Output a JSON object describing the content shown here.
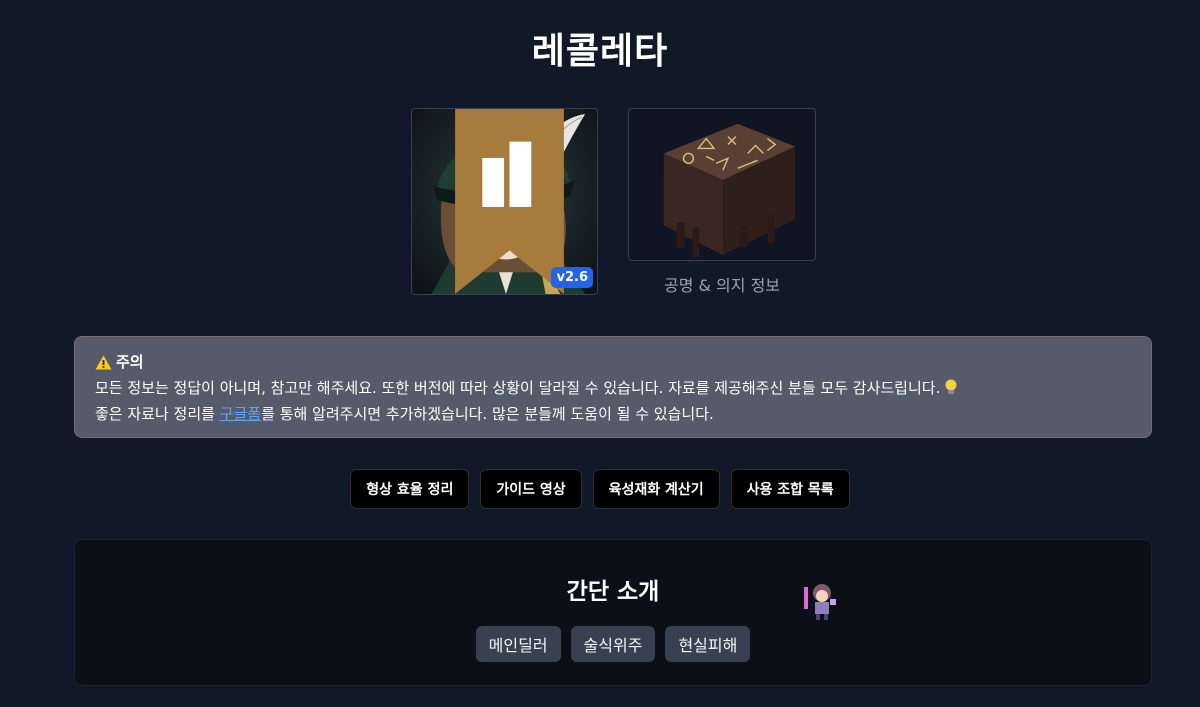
{
  "page": {
    "title": "레콜레타"
  },
  "character": {
    "version": "v2.6",
    "icon": "character-portrait",
    "attribute_icon": "intellect-attribute-icon"
  },
  "psychube": {
    "caption": "공명 & 의지 정보",
    "icon": "rune-table-image"
  },
  "notice": {
    "heading": "주의",
    "line1": "모든 정보는 정답이 아니며, 참고만 해주세요. 또한 버전에 따라 상황이 달라질 수 있습니다. 자료를 제공해주신 분들 모두 감사드립니다.",
    "line2_before": "좋은 자료나 정리를 ",
    "line2_link": "구글폼",
    "line2_after": "를 통해 알려주시면 추가하겠습니다. 많은 분들께 도움이 될 수 있습니다.",
    "colors": {
      "background": "#565b6b",
      "link": "#60a5fa"
    }
  },
  "buttons": [
    {
      "label": "형상 효율 정리"
    },
    {
      "label": "가이드 영상"
    },
    {
      "label": "육성재화 계산기"
    },
    {
      "label": "사용 조합 목록"
    }
  ],
  "intro": {
    "title": "간단 소개",
    "tags": [
      "메인딜러",
      "술식위주",
      "현실피해"
    ]
  },
  "colors": {
    "page_bg": "#111827",
    "version_badge": "#2563eb",
    "tag_bg": "#374151"
  }
}
